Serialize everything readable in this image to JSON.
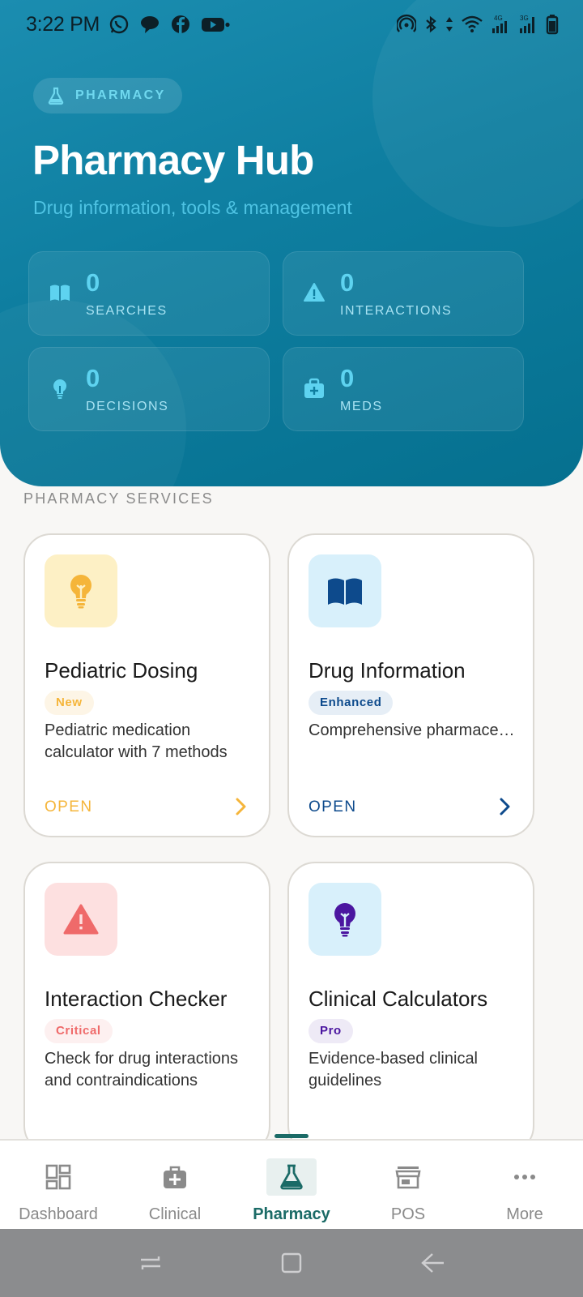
{
  "status_bar": {
    "time": "3:22 PM",
    "left_icons": [
      "whatsapp-icon",
      "chat-bubble-icon",
      "facebook-icon",
      "youtube-icon"
    ],
    "right_icons": [
      "hotspot-icon",
      "bluetooth-icon",
      "data-arrows-icon",
      "wifi-icon",
      "signal-4g-icon",
      "signal-3g-icon",
      "battery-icon"
    ]
  },
  "hero": {
    "chip_label": "PHARMACY",
    "title": "Pharmacy Hub",
    "subtitle": "Drug information, tools & management",
    "stats": [
      {
        "value": "0",
        "label": "SEARCHES",
        "icon": "book-icon"
      },
      {
        "value": "0",
        "label": "INTERACTIONS",
        "icon": "warning-icon"
      },
      {
        "value": "0",
        "label": "DECISIONS",
        "icon": "lightbulb-icon"
      },
      {
        "value": "0",
        "label": "MEDS",
        "icon": "medkit-icon"
      }
    ]
  },
  "services": {
    "section_title": "PHARMACY SERVICES",
    "cards": [
      {
        "title": "Pediatric Dosing",
        "badge": "New",
        "description": "Pediatric medication calculator with 7 methods",
        "action": "OPEN",
        "icon": "lightbulb-icon",
        "accent": "#f5b53a"
      },
      {
        "title": "Drug Information",
        "badge": "Enhanced",
        "description": "Comprehensive pharmaceutical knowledg…",
        "action": "OPEN",
        "icon": "book-icon",
        "accent": "#0d4a8c"
      },
      {
        "title": "Interaction Checker",
        "badge": "Critical",
        "description": "Check for drug interactions and contraindications",
        "icon": "warning-icon",
        "accent": "#ef6a6a"
      },
      {
        "title": "Clinical Calculators",
        "badge": "Pro",
        "description": "Evidence-based clinical guidelines",
        "icon": "lightbulb-icon",
        "accent": "#4b16a0"
      }
    ]
  },
  "bottom_nav": {
    "items": [
      {
        "label": "Dashboard",
        "icon": "dashboard-icon"
      },
      {
        "label": "Clinical",
        "icon": "medical-bag-icon"
      },
      {
        "label": "Pharmacy",
        "icon": "flask-icon"
      },
      {
        "label": "POS",
        "icon": "store-icon"
      },
      {
        "label": "More",
        "icon": "more-dots-icon"
      }
    ],
    "active": "Pharmacy"
  },
  "colors": {
    "hero_primary": "#0e7ea0",
    "hero_accent": "#5ed3f0",
    "nav_active": "#1b6b67"
  }
}
